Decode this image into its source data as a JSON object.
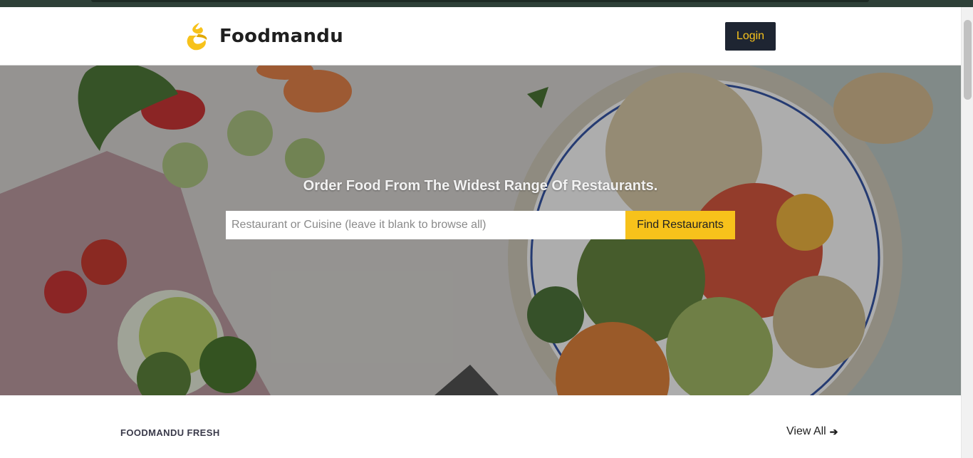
{
  "brand": {
    "name": "Foodmandu",
    "accent": "#f7c21b",
    "dark": "#1e2532"
  },
  "nav": {
    "login_label": "Login"
  },
  "hero": {
    "title": "Order Food From The Widest Range Of Restaurants.",
    "search_placeholder": "Restaurant or Cuisine (leave it blank to browse all)",
    "search_value": "",
    "find_label": "Find Restaurants"
  },
  "section": {
    "title": "FOODMANDU FRESH",
    "view_all_label": "View All",
    "view_all_icon": "arrow-right-icon"
  }
}
